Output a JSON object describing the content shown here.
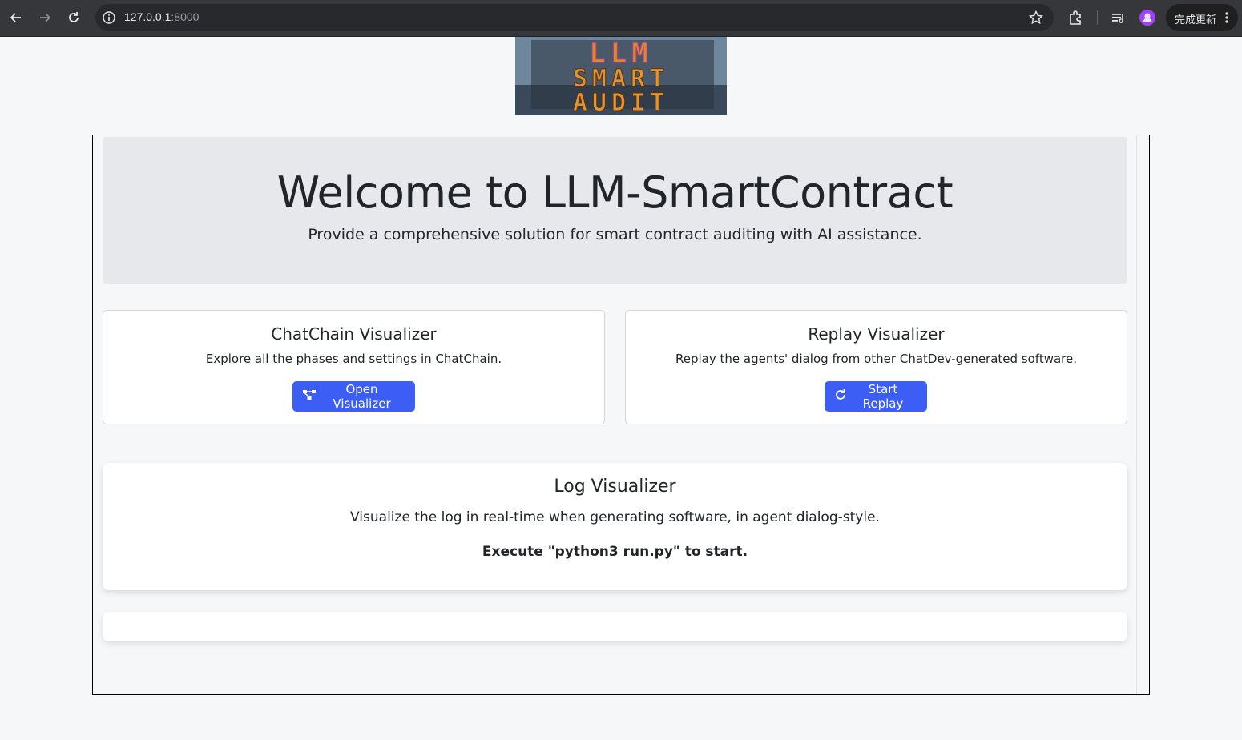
{
  "browser": {
    "url_host": "127.0.0.1",
    "url_port": ":8000",
    "update_button_label": "完成更新",
    "icons": [
      "back-arrow-icon",
      "forward-arrow-icon",
      "reload-icon",
      "info-icon",
      "star-icon",
      "extensions-icon",
      "tab-search-icon",
      "profile-icon",
      "more-vertical-icon"
    ]
  },
  "logo": {
    "text_lines": [
      "LLM",
      "SMART",
      "AUDIT"
    ]
  },
  "hero": {
    "title": "Welcome to LLM-SmartContract",
    "subtitle": "Provide a comprehensive solution for smart contract auditing with AI assistance."
  },
  "cards": {
    "chatchain": {
      "title": "ChatChain Visualizer",
      "description": "Explore all the phases and settings in ChatChain.",
      "button_label": "Open Visualizer",
      "button_icon": "diagram-icon"
    },
    "replay": {
      "title": "Replay Visualizer",
      "description": "Replay the agents' dialog from other ChatDev-generated software.",
      "button_label": "Start Replay",
      "button_icon": "replay-icon"
    }
  },
  "log": {
    "title": "Log Visualizer",
    "description": "Visualize the log in real-time when generating software, in agent dialog-style.",
    "command": "Execute \"python3 run.py\" to start."
  },
  "colors": {
    "accent": "#3d5ef5",
    "hero_bg": "#e6e8ec",
    "page_bg": "#f6f7f9",
    "chrome_bg": "#35373b"
  }
}
